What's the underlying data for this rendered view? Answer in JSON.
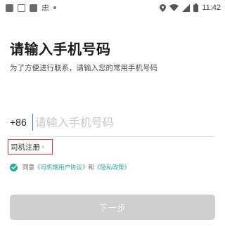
{
  "status_bar": {
    "time": "11:42",
    "app_glyph": "忠"
  },
  "page": {
    "title": "请输入手机号码",
    "subtitle": "为了方便进行联系，请输入您的常用手机号码"
  },
  "phone": {
    "country_code": "+86",
    "placeholder": "请输入手机号码",
    "value": ""
  },
  "driver_register": {
    "label": "司机注册",
    "chevron": "›"
  },
  "agreement": {
    "prefix": "同意",
    "user_agreement": "《司机端用户协议》",
    "and": "和",
    "privacy_policy": "《隐私政策》",
    "checked": true,
    "accent_color": "#26a69a"
  },
  "next_button": {
    "label": "下一步",
    "enabled": false
  },
  "colors": {
    "highlight_border": "#e53935",
    "cursor": "#1e88e5",
    "button_disabled": "#cfcfcf"
  }
}
